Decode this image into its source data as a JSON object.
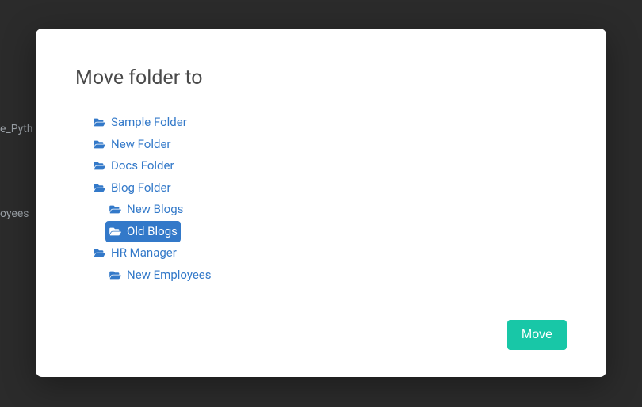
{
  "background": {
    "hint1": "e_Pyth",
    "hint2": "oyees"
  },
  "modal": {
    "title": "Move folder to",
    "moveButton": "Move",
    "tree": [
      {
        "label": "Sample Folder",
        "depth": 0,
        "selected": false
      },
      {
        "label": "New Folder",
        "depth": 0,
        "selected": false
      },
      {
        "label": "Docs Folder",
        "depth": 0,
        "selected": false
      },
      {
        "label": "Blog Folder",
        "depth": 0,
        "selected": false
      },
      {
        "label": "New Blogs",
        "depth": 1,
        "selected": false
      },
      {
        "label": "Old Blogs",
        "depth": 1,
        "selected": true
      },
      {
        "label": "HR Manager",
        "depth": 0,
        "selected": false
      },
      {
        "label": "New Employees",
        "depth": 1,
        "selected": false
      }
    ]
  },
  "colors": {
    "link": "#3379c9",
    "accent": "#18c7a7",
    "modalBg": "#ffffff",
    "pageBg": "#2b2b2b"
  }
}
